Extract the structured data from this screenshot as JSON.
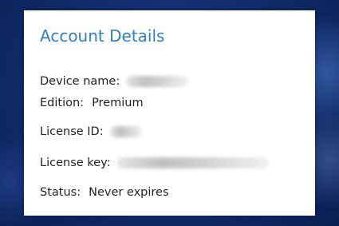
{
  "account_details": {
    "title": "Account Details",
    "rows": [
      {
        "label": "Device name:",
        "value": "",
        "redacted": true
      },
      {
        "label": "Edition:",
        "value": "Premium",
        "redacted": false
      },
      {
        "label": "License ID:",
        "value": "",
        "redacted": true
      },
      {
        "label": "License key:",
        "value": "",
        "redacted": true
      },
      {
        "label": "Status:",
        "value": "Never expires",
        "redacted": false
      }
    ]
  },
  "colors": {
    "title": "#2f7fc3",
    "text": "#222222",
    "card_background": "#ffffff",
    "page_background": "#123073"
  }
}
